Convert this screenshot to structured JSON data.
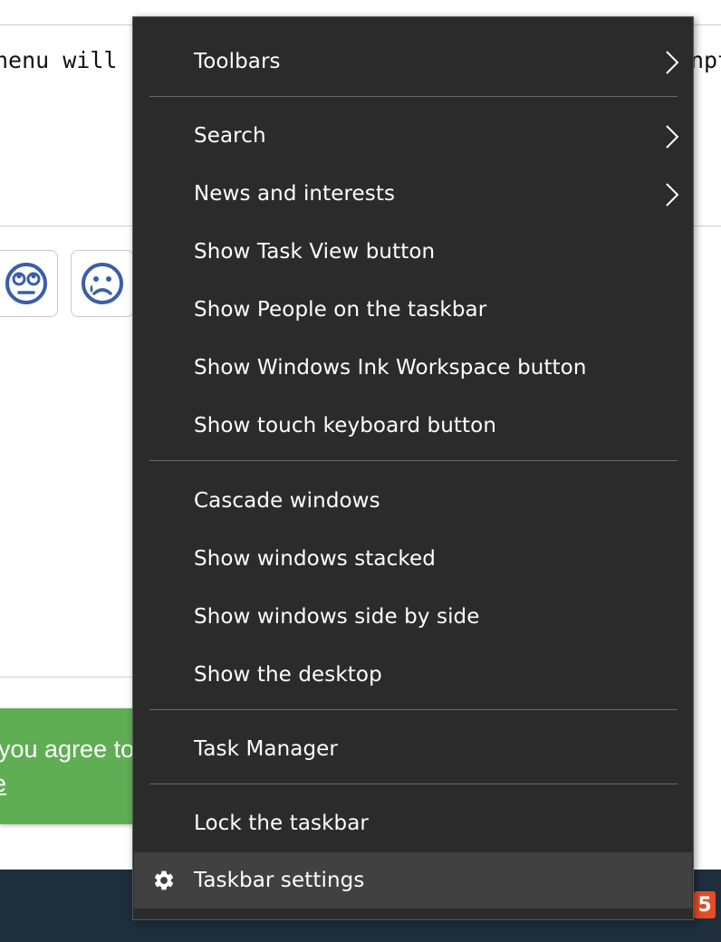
{
  "background": {
    "code_text_left": "nenu will",
    "code_text_right": "npt",
    "cookie_banner": {
      "text": "you agree to",
      "link": "e"
    },
    "emoji_buttons": [
      {
        "icon": "rolling-eyes-face-icon"
      },
      {
        "icon": "crying-face-icon"
      }
    ],
    "tray_icon_label": "5"
  },
  "menu": {
    "toolbars": "Toolbars",
    "search": "Search",
    "news": "News and interests",
    "task_view": "Show Task View button",
    "people": "Show People on the taskbar",
    "ink": "Show Windows Ink Workspace button",
    "touch_keyboard": "Show touch keyboard button",
    "cascade": "Cascade windows",
    "stacked": "Show windows stacked",
    "side_by_side": "Show windows side by side",
    "desktop": "Show the desktop",
    "task_manager": "Task Manager",
    "lock": "Lock the taskbar",
    "settings": "Taskbar settings"
  },
  "colors": {
    "menu_bg": "#2b2b2b",
    "menu_hover": "#414141",
    "banner_green": "#5fae54",
    "taskbar": "#1f2e3c",
    "emoji_blue": "#3a5fa8"
  }
}
